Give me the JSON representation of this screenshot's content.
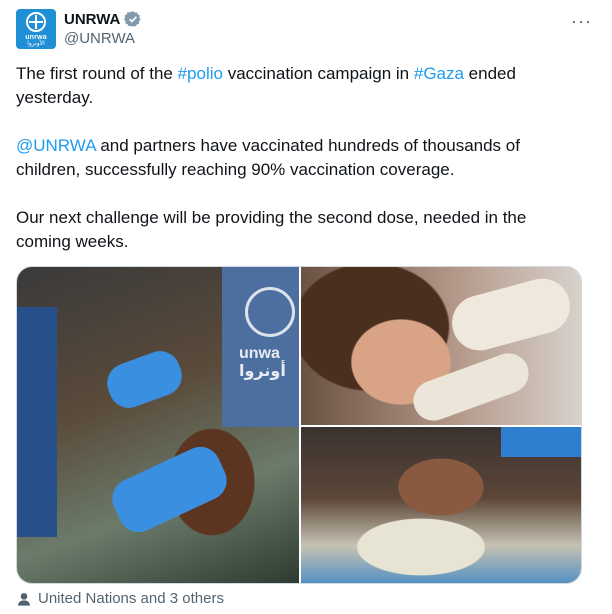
{
  "author": {
    "display_name": "UNRWA",
    "handle": "@UNRWA",
    "avatar_text_line1": "unrwa",
    "avatar_text_line2": "الأونروا",
    "verified": true
  },
  "more_label": "···",
  "tweet": {
    "para1_a": "The first round of the ",
    "para1_link1": "#polio",
    "para1_b": " vaccination campaign in ",
    "para1_link2": "#Gaza",
    "para1_c": " ended yesterday.",
    "para2_link": "@UNRWA",
    "para2_text": " and partners have vaccinated hundreds of thousands of children, successfully reaching 90% vaccination coverage.",
    "para3_text": "Our next challenge will be providing the second dose, needed in the coming weeks."
  },
  "media": {
    "photo1_sign": "unwa\nأونروا"
  },
  "footer": {
    "tagged_text": "United Nations and 3 others"
  },
  "colors": {
    "link": "#1d9bf0",
    "secondary_text": "#536471",
    "brand_blue": "#1f8fd6"
  },
  "icons": [
    "un-emblem-icon",
    "verified-badge-icon",
    "more-icon",
    "person-icon"
  ]
}
